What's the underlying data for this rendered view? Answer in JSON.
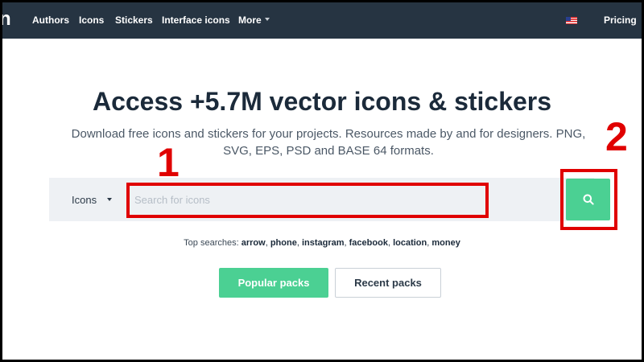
{
  "nav": {
    "logo": "n",
    "items": [
      {
        "label": "Authors"
      },
      {
        "label": "Icons"
      },
      {
        "label": "Stickers"
      },
      {
        "label": "Interface icons"
      },
      {
        "label": "More"
      }
    ],
    "pricing": "Pricing"
  },
  "hero": {
    "title": "Access +5.7M vector icons & stickers",
    "subtitle": "Download free icons and stickers for your projects. Resources made by and for designers. PNG, SVG, EPS, PSD and BASE 64 formats."
  },
  "search": {
    "type": "Icons",
    "placeholder": "Search for icons",
    "value": ""
  },
  "top_searches": {
    "label": "Top searches:",
    "terms": [
      "arrow",
      "phone",
      "instagram",
      "facebook",
      "location",
      "money"
    ]
  },
  "buttons": {
    "popular": "Popular packs",
    "recent": "Recent packs"
  },
  "annotations": {
    "one": "1",
    "two": "2"
  },
  "colors": {
    "nav_bg": "#263442",
    "accent": "#4bd093",
    "annotation": "#e00000"
  }
}
